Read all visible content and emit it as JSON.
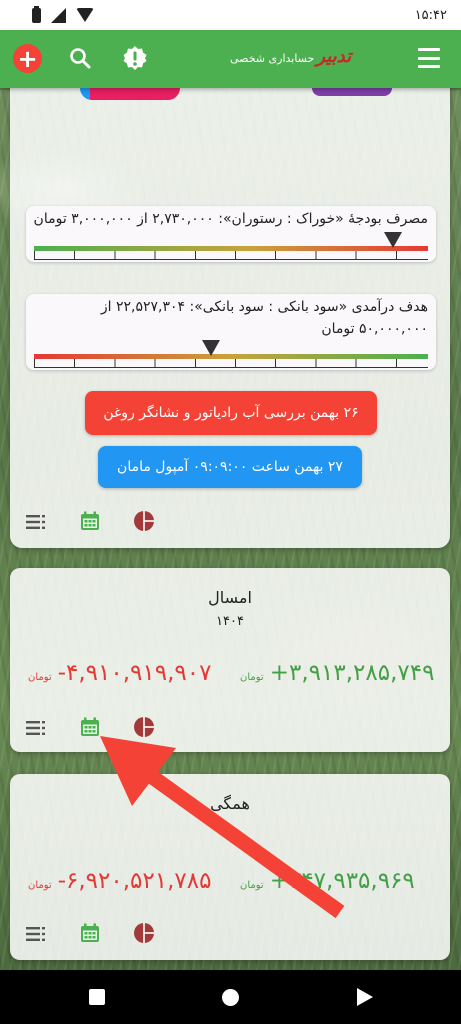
{
  "status_bar": {
    "time": "۱۵:۴۲"
  },
  "app_bar": {
    "brand_logo": "تدبیر",
    "brand_sub": "حسابداری شخصی",
    "add_label": "+"
  },
  "card1": {
    "budget1": {
      "text": "مصرف بودجهٔ «خوراک : رستوران»: ۲,۷۳۰,۰۰۰ از ۳,۰۰۰,۰۰۰ تومان",
      "progress": 0.91
    },
    "budget2": {
      "text": "هدف درآمدی «سود بانکی : سود بانکی»: ۲۲,۵۲۷,۳۰۴ از ۵۰,۰۰۰,۰۰۰ تومان",
      "progress": 0.45
    },
    "event_red": "۲۶ بهمن بررسی آب رادیاتور و نشانگر روغن",
    "event_blue": "۲۷ بهمن ساعت ۰۹:۰۹:۰۰ آمپول مامان"
  },
  "card2": {
    "title": "امسال",
    "year": "۱۴۰۴",
    "income": "+۳,۹۱۳,۲۸۵,۷۴۹",
    "expense": "-۴,۹۱۰,۹۱۹,۹۰۷",
    "unit": "تومان"
  },
  "card3": {
    "title": "همگی",
    "income": "+۳۴۷,۹۳۵,۹۶۹",
    "expense": "-۶,۹۲۰,۵۲۱,۷۸۵",
    "unit": "تومان"
  },
  "colors": {
    "primary": "#4caf50",
    "accent_red": "#f44336",
    "accent_blue": "#2196f3",
    "income": "#43a047",
    "expense": "#e53935",
    "pie_icon": "#a13b3b"
  },
  "icons": [
    "add-icon",
    "search-icon",
    "alert-badge-icon",
    "menu-icon",
    "list-icon",
    "calendar-icon",
    "pie-chart-icon"
  ]
}
